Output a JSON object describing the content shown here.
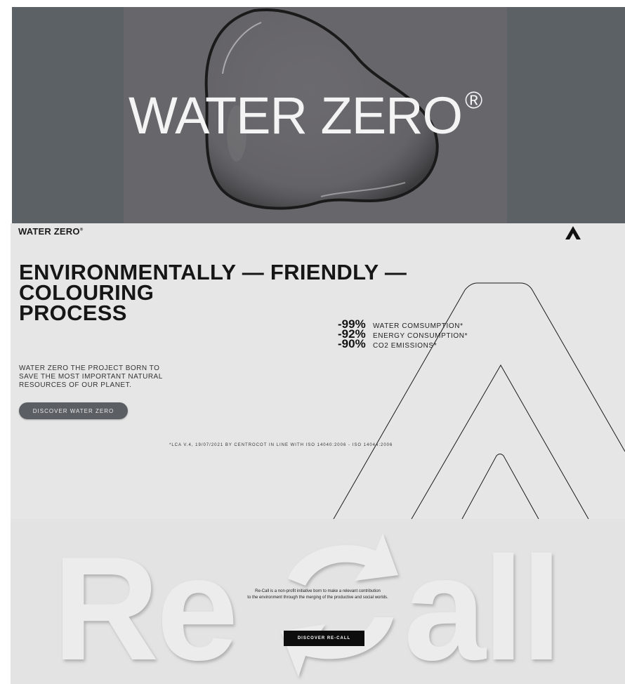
{
  "hero": {
    "title": "WATER ZERO",
    "registered_mark": "®"
  },
  "brand": {
    "name": "WATER ZERO",
    "registered_mark": "®",
    "logo_icon": "triangle-a-logo-icon"
  },
  "env": {
    "headline_lines": [
      "ENVIRONMENTALLY — FRIENDLY —",
      "COLOURING",
      "PROCESS"
    ],
    "stats": [
      {
        "value": "-99%",
        "label": "WATER COMSUMPTION*"
      },
      {
        "value": "-92%",
        "label": "ENERGY CONSUMPTION*"
      },
      {
        "value": "-90%",
        "label": "CO2 EMISSIONS*"
      }
    ],
    "intro_lines": [
      "WATER ZERO THE PROJECT BORN TO",
      "SAVE THE MOST IMPORTANT NATURAL",
      "RESOURCES OF OUR PLANET."
    ],
    "cta_label": "DISCOVER WATER ZERO",
    "footnote": "*LCA V.4, 19/07/2021 BY CENTROCOT IN LINE WITH ISO 14040:2006 - ISO 14044:2006"
  },
  "recall": {
    "art_wordmark": "ReCall",
    "description_lines": [
      "Re-Call is a non-profit initiative born to make a relevant contribution",
      "to the environment through the merging of the productive and social worlds."
    ],
    "cta_label": "DISCOVER RE-CALL"
  },
  "colors": {
    "hero_bg": "#5c6166",
    "hero_center": "#67666a",
    "env_bg": "#e6e6e6",
    "cta_bg": "#5b5f64",
    "recall_bg": "#e3e3e3",
    "recall_btn_bg": "#0d0d0d"
  }
}
